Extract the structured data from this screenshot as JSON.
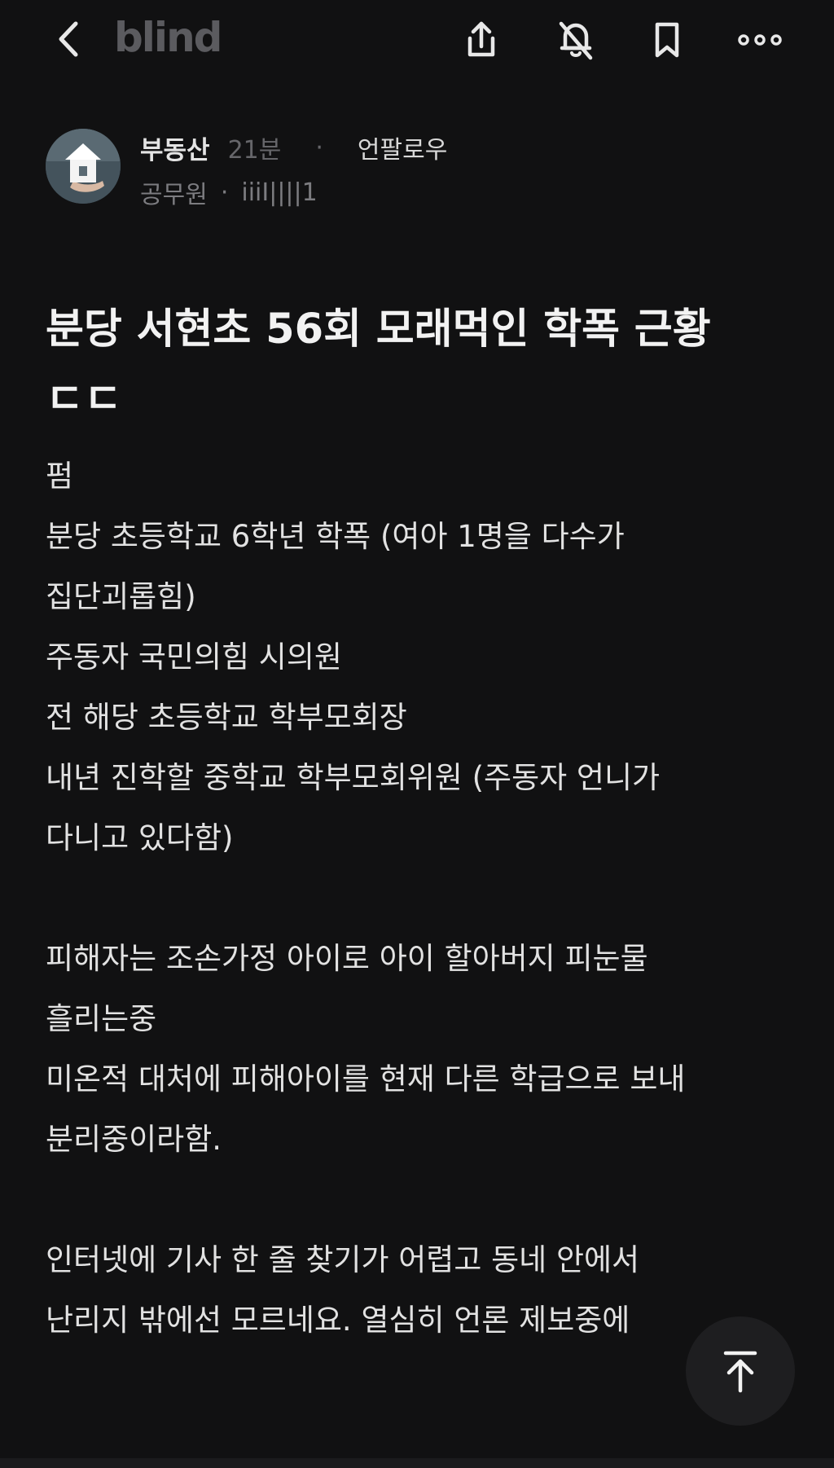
{
  "app": {
    "logo": "blind"
  },
  "topbar": {
    "icons": [
      "back-chevron-icon",
      "share-icon",
      "notifications-off-icon",
      "bookmark-icon",
      "more-horizontal-icon"
    ]
  },
  "post": {
    "author": "부동산",
    "time": "21분",
    "dot": "·",
    "unfollow_label": "언팔로우",
    "company": "공무원",
    "handle": "iiiI||||1",
    "avatar_icon": "house-in-hand-icon",
    "title_line1": "분당 서현초 56회 모래먹인 학폭 근황",
    "title_line2": "ㄷㄷ",
    "body": [
      "펌",
      "분당 초등학교 6학년 학폭 (여아 1명을 다수가",
      "집단괴롭힘)",
      "주동자 국민의힘 시의원",
      "전 해당 초등학교 학부모회장",
      "내년 진학할 중학교 학부모회위원 (주동자 언니가",
      "다니고 있다함)",
      "",
      "피해자는 조손가정 아이로 아이 할아버지 피눈물",
      "흘리는중",
      "미온적 대처에 피해아이를 현재 다른 학급으로 보내",
      "분리중이라함.",
      "",
      "인터넷에 기사 한 줄 찾기가 어렵고 동네 안에서",
      "난리지 밖에선 모르네요. 열심히 언론 제보중에"
    ]
  },
  "scroll_top": {
    "icon": "arrow-up-to-top-icon"
  }
}
